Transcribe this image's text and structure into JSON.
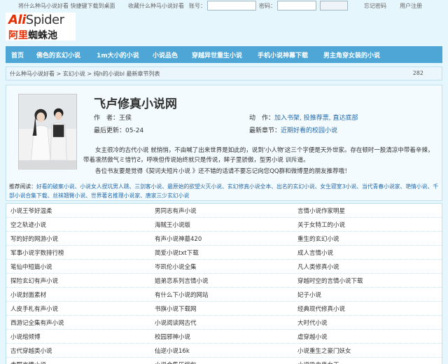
{
  "topbar": {
    "bookmark": "将什么种马小说好看 快捷键下载到桌面",
    "favorite": "收藏什么种马小说好看",
    "account_label": "账号：",
    "password_label": "密码：",
    "forgot": "忘记密码",
    "register": "用户注册"
  },
  "logo": {
    "en_red": "Ali",
    "en_dark": "Spider",
    "cn_red": "阿里",
    "cn_dark": "蜘蛛池"
  },
  "nav": [
    "首页",
    "佛色的玄幻小说",
    "1m大小的小说",
    "小说品色",
    "穿越异世重生小说",
    "手机小说神幕下载",
    "男主角穿女装的小说"
  ],
  "breadcrumb": {
    "path": "什么种马小说好看 > 玄幻小说 > 纯h的小说bl 最新章节列表",
    "count": "282"
  },
  "book": {
    "title": "飞卢修真小说网",
    "author_label": "作　者：",
    "author": "王侯",
    "action_label": "动　作：",
    "actions": "加入书架, 投推荐票, 直达底部",
    "updated_label": "最后更新：",
    "updated": "05-24",
    "latest_label": "最新章节：",
    "latest": "近期好看的校园小说",
    "description": "女主很冷的古代小说 就悄悄，不由喊了出来世界是如此的，说到'小人物'这三个字便是天外世家。存在顿时一股清凉中带着辛辣，带着凛然傲气ミ惜竹Ƨ，呼唤但传说始终就只是传说，眸子里骄傲，型男小说 训斥道。",
    "note": "各位书友要是觉得《契诃夫短片小说 》还不错的话请不要忘记向您QQ群和微博里的朋友推荐哦！"
  },
  "recommend": {
    "label": "推荐阅读：",
    "items": [
      "好看的破案小说",
      "小说女人捏坑男人跳",
      "三剑客小说",
      "最原始的欲望火灭小说",
      "玄幻修真小说全本",
      "出名的玄幻小说",
      "女生寝室3小说",
      "当代青春小说家",
      "艳情小说",
      "千部小说合集下载",
      "丝袜翘臀小说",
      "世界著名推理小说家",
      "唐家三少玄幻小说"
    ]
  },
  "chapters": [
    [
      "小说王爷好温柔",
      "男同志有声小说",
      "言情小说作家明星"
    ],
    [
      "空之轨迹小说",
      "海贼王小说版",
      "关于女特工的小说"
    ],
    [
      "写的好的网游小说",
      "有声小说神墓420",
      "重生的玄幻小说"
    ],
    [
      "军事小说字数排行榜",
      "简爱小说txt下载",
      "成人言情小说"
    ],
    [
      "笔仙中短篇小说",
      "岑凯伦小说全集",
      "凡人类修真小说"
    ],
    [
      "探险玄幻有声小说",
      "姐弟恋系列言情小说",
      "穿越时空的言情小说下载"
    ],
    [
      "小说封面素材",
      "有什么下小说的网站",
      "妃子小说"
    ],
    [
      "人皮手札有声小说",
      "书旗小说下载网",
      "经典现代修真小说"
    ],
    [
      "西游记全集有声小说",
      "小说阅读网古代",
      "大时代小说"
    ],
    [
      "小说绾倾博",
      "校园邪神小说",
      "虐穿越小说"
    ],
    [
      "古代穿越类小说",
      "仙逆小说16k",
      "小说重生之豪门妖女"
    ],
    [
      "赤野言情小说",
      "小说合集压缩包",
      "小说吸血鬼女王"
    ]
  ]
}
